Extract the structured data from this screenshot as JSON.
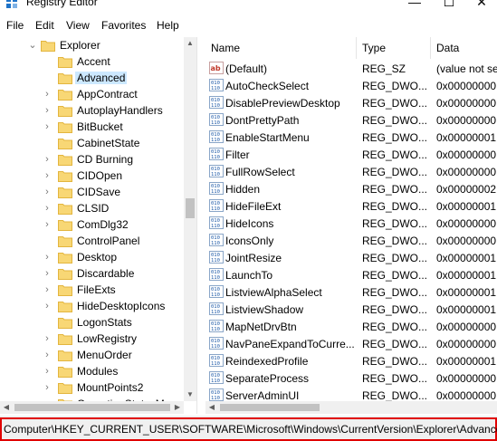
{
  "window": {
    "title": "Registry Editor",
    "minimize_glyph": "—",
    "maximize_glyph": "☐",
    "close_glyph": "✕"
  },
  "menubar": {
    "items": [
      "File",
      "Edit",
      "View",
      "Favorites",
      "Help"
    ]
  },
  "tree": {
    "parent": {
      "label": "Explorer",
      "expanded": true
    },
    "items": [
      {
        "label": "Accent",
        "has_children": false
      },
      {
        "label": "Advanced",
        "has_children": false,
        "selected": true
      },
      {
        "label": "AppContract",
        "has_children": true
      },
      {
        "label": "AutoplayHandlers",
        "has_children": true
      },
      {
        "label": "BitBucket",
        "has_children": true
      },
      {
        "label": "CabinetState",
        "has_children": false
      },
      {
        "label": "CD Burning",
        "has_children": true
      },
      {
        "label": "CIDOpen",
        "has_children": true
      },
      {
        "label": "CIDSave",
        "has_children": true
      },
      {
        "label": "CLSID",
        "has_children": true
      },
      {
        "label": "ComDlg32",
        "has_children": true
      },
      {
        "label": "ControlPanel",
        "has_children": false
      },
      {
        "label": "Desktop",
        "has_children": true
      },
      {
        "label": "Discardable",
        "has_children": true
      },
      {
        "label": "FileExts",
        "has_children": true
      },
      {
        "label": "HideDesktopIcons",
        "has_children": true
      },
      {
        "label": "LogonStats",
        "has_children": false
      },
      {
        "label": "LowRegistry",
        "has_children": true
      },
      {
        "label": "MenuOrder",
        "has_children": true
      },
      {
        "label": "Modules",
        "has_children": true
      },
      {
        "label": "MountPoints2",
        "has_children": true
      },
      {
        "label": "OperationStatusM",
        "has_children": true
      }
    ]
  },
  "list": {
    "columns": {
      "name": "Name",
      "type": "Type",
      "data": "Data"
    },
    "rows": [
      {
        "name": "(Default)",
        "type": "REG_SZ",
        "data": "(value not se",
        "icon": "string-value-icon"
      },
      {
        "name": "AutoCheckSelect",
        "type": "REG_DWO...",
        "data": "0x00000000 (",
        "icon": "binary-value-icon"
      },
      {
        "name": "DisablePreviewDesktop",
        "type": "REG_DWO...",
        "data": "0x00000000 (",
        "icon": "binary-value-icon"
      },
      {
        "name": "DontPrettyPath",
        "type": "REG_DWO...",
        "data": "0x00000000 (",
        "icon": "binary-value-icon"
      },
      {
        "name": "EnableStartMenu",
        "type": "REG_DWO...",
        "data": "0x00000001 (",
        "icon": "binary-value-icon"
      },
      {
        "name": "Filter",
        "type": "REG_DWO...",
        "data": "0x00000000 (",
        "icon": "binary-value-icon"
      },
      {
        "name": "FullRowSelect",
        "type": "REG_DWO...",
        "data": "0x00000000 (",
        "icon": "binary-value-icon"
      },
      {
        "name": "Hidden",
        "type": "REG_DWO...",
        "data": "0x00000002 (",
        "icon": "binary-value-icon"
      },
      {
        "name": "HideFileExt",
        "type": "REG_DWO...",
        "data": "0x00000001 (",
        "icon": "binary-value-icon"
      },
      {
        "name": "HideIcons",
        "type": "REG_DWO...",
        "data": "0x00000000 (",
        "icon": "binary-value-icon"
      },
      {
        "name": "IconsOnly",
        "type": "REG_DWO...",
        "data": "0x00000000 (",
        "icon": "binary-value-icon"
      },
      {
        "name": "JointResize",
        "type": "REG_DWO...",
        "data": "0x00000001 (",
        "icon": "binary-value-icon"
      },
      {
        "name": "LaunchTo",
        "type": "REG_DWO...",
        "data": "0x00000001 (",
        "icon": "binary-value-icon"
      },
      {
        "name": "ListviewAlphaSelect",
        "type": "REG_DWO...",
        "data": "0x00000001 (",
        "icon": "binary-value-icon"
      },
      {
        "name": "ListviewShadow",
        "type": "REG_DWO...",
        "data": "0x00000001 (",
        "icon": "binary-value-icon"
      },
      {
        "name": "MapNetDrvBtn",
        "type": "REG_DWO...",
        "data": "0x00000000 (",
        "icon": "binary-value-icon"
      },
      {
        "name": "NavPaneExpandToCurre...",
        "type": "REG_DWO...",
        "data": "0x00000000 (",
        "icon": "binary-value-icon"
      },
      {
        "name": "ReindexedProfile",
        "type": "REG_DWO...",
        "data": "0x00000001 (",
        "icon": "binary-value-icon"
      },
      {
        "name": "SeparateProcess",
        "type": "REG_DWO...",
        "data": "0x00000000 (",
        "icon": "binary-value-icon"
      },
      {
        "name": "ServerAdminUI",
        "type": "REG_DWO...",
        "data": "0x00000000 (",
        "icon": "binary-value-icon"
      }
    ]
  },
  "statusbar": {
    "path": "Computer\\HKEY_CURRENT_USER\\SOFTWARE\\Microsoft\\Windows\\CurrentVersion\\Explorer\\Advanced",
    "highlight_color": "#e00000"
  },
  "colors": {
    "folder": "#f8d775",
    "folder_dark": "#e3b53e",
    "selection": "#cce8ff",
    "binary_icon": "#1e5aa8",
    "string_icon": "#c0392b"
  }
}
